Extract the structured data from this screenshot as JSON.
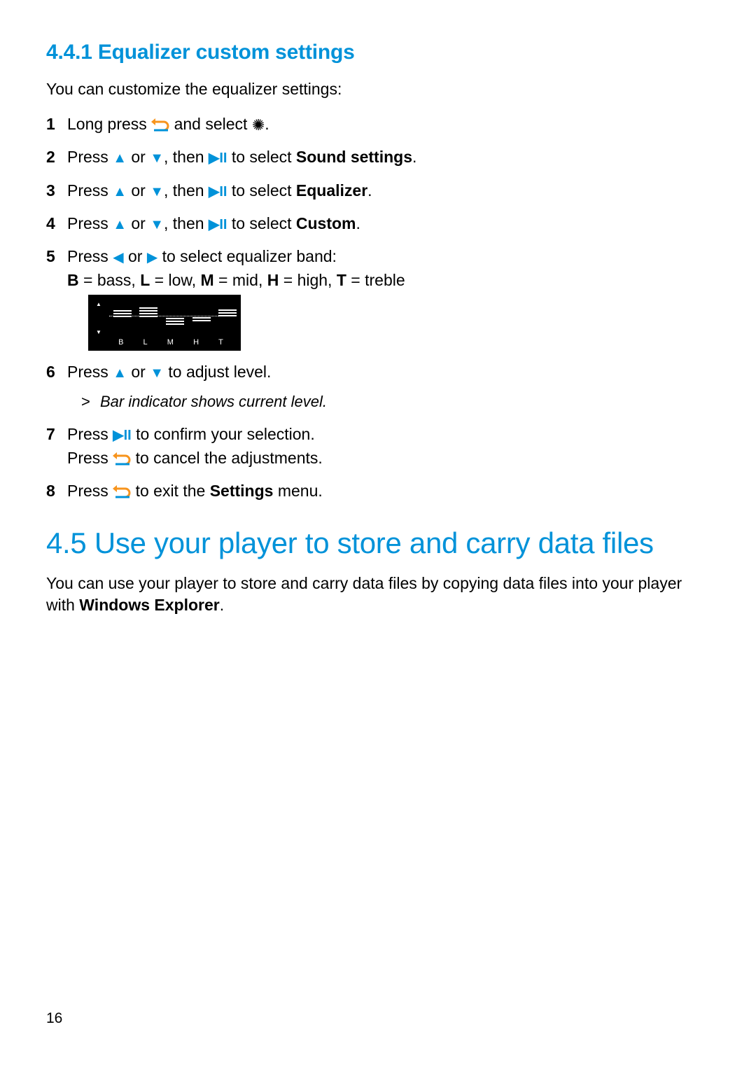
{
  "section_441": {
    "title": "4.4.1 Equalizer custom settings",
    "intro": "You can customize the equalizer settings:",
    "steps": {
      "s1": {
        "num": "1",
        "a": "Long press ",
        "b": " and select ",
        "c": "."
      },
      "s2": {
        "num": "2",
        "a": "Press ",
        "b": " or ",
        "c": ", then ",
        "d": " to select ",
        "bold": "Sound settings",
        "end": "."
      },
      "s3": {
        "num": "3",
        "a": "Press ",
        "b": " or ",
        "c": ", then ",
        "d": " to select ",
        "bold": "Equalizer",
        "end": "."
      },
      "s4": {
        "num": "4",
        "a": "Press ",
        "b": " or ",
        "c": ", then ",
        "d": " to select ",
        "bold": "Custom",
        "end": "."
      },
      "s5": {
        "num": "5",
        "a": "Press ",
        "b": " or ",
        "c": " to select equalizer band:",
        "legend": {
          "b_k": "B",
          "b_v": " = bass, ",
          "l_k": "L",
          "l_v": " = low, ",
          "m_k": "M",
          "m_v": " = mid, ",
          "h_k": "H",
          "h_v": " = high, ",
          "t_k": "T",
          "t_v": " = treble"
        },
        "eq_labels": {
          "b": "B",
          "l": "L",
          "m": "M",
          "h": "H",
          "t": "T"
        }
      },
      "s6": {
        "num": "6",
        "a": "Press ",
        "b": " or ",
        "c": " to adjust level.",
        "note": "Bar indicator shows current level."
      },
      "s7": {
        "num": "7",
        "a": "Press ",
        "b": " to confirm your selection.",
        "c": "Press ",
        "d": " to cancel the adjustments."
      },
      "s8": {
        "num": "8",
        "a": "Press ",
        "b": " to exit the ",
        "bold": "Settings",
        "end": " menu."
      }
    }
  },
  "section_45": {
    "title": "4.5  Use your player to store and carry data files",
    "body_a": "You can use your player to store and carry data files by copying data files into your player with ",
    "body_bold": "Windows Explorer",
    "body_end": "."
  },
  "page_number": "16"
}
